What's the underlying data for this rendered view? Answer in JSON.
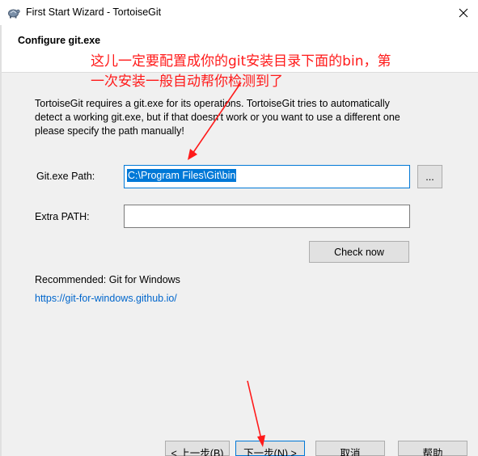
{
  "window": {
    "title": "First Start Wizard - TortoiseGit",
    "close_glyph": "✕"
  },
  "header": {
    "title": "Configure git.exe"
  },
  "annotation": {
    "line1": "这儿一定要配置成你的git安装目录下面的bin，第",
    "line2": "一次安装一般自动帮你检测到了",
    "color": "#ff1a1a"
  },
  "description": {
    "line1": "TortoiseGit requires a git.exe for its operations. TortoiseGit tries to automatically",
    "line2": "detect a working git.exe, but if that doesn't work or you want to use a different one",
    "line3": "please specify the path manually!"
  },
  "form": {
    "git_path_label": "Git.exe Path:",
    "git_path_value": "C:\\Program Files\\Git\\bin",
    "browse_label": "...",
    "extra_path_label": "Extra PATH:",
    "extra_path_value": "",
    "check_now_label": "Check now"
  },
  "recommended": {
    "label": "Recommended: Git for Windows",
    "link": "https://git-for-windows.github.io/"
  },
  "footer": {
    "back_label": "< 上一步(B)",
    "next_label": "下一步(N) >",
    "cancel_label": "取消",
    "help_label": "帮助"
  },
  "icons": {
    "app": "tortoisegit-app-icon",
    "close": "close-icon"
  },
  "colors": {
    "accent": "#0078d7",
    "link": "#0066cc",
    "annotation": "#ff1a1a"
  }
}
